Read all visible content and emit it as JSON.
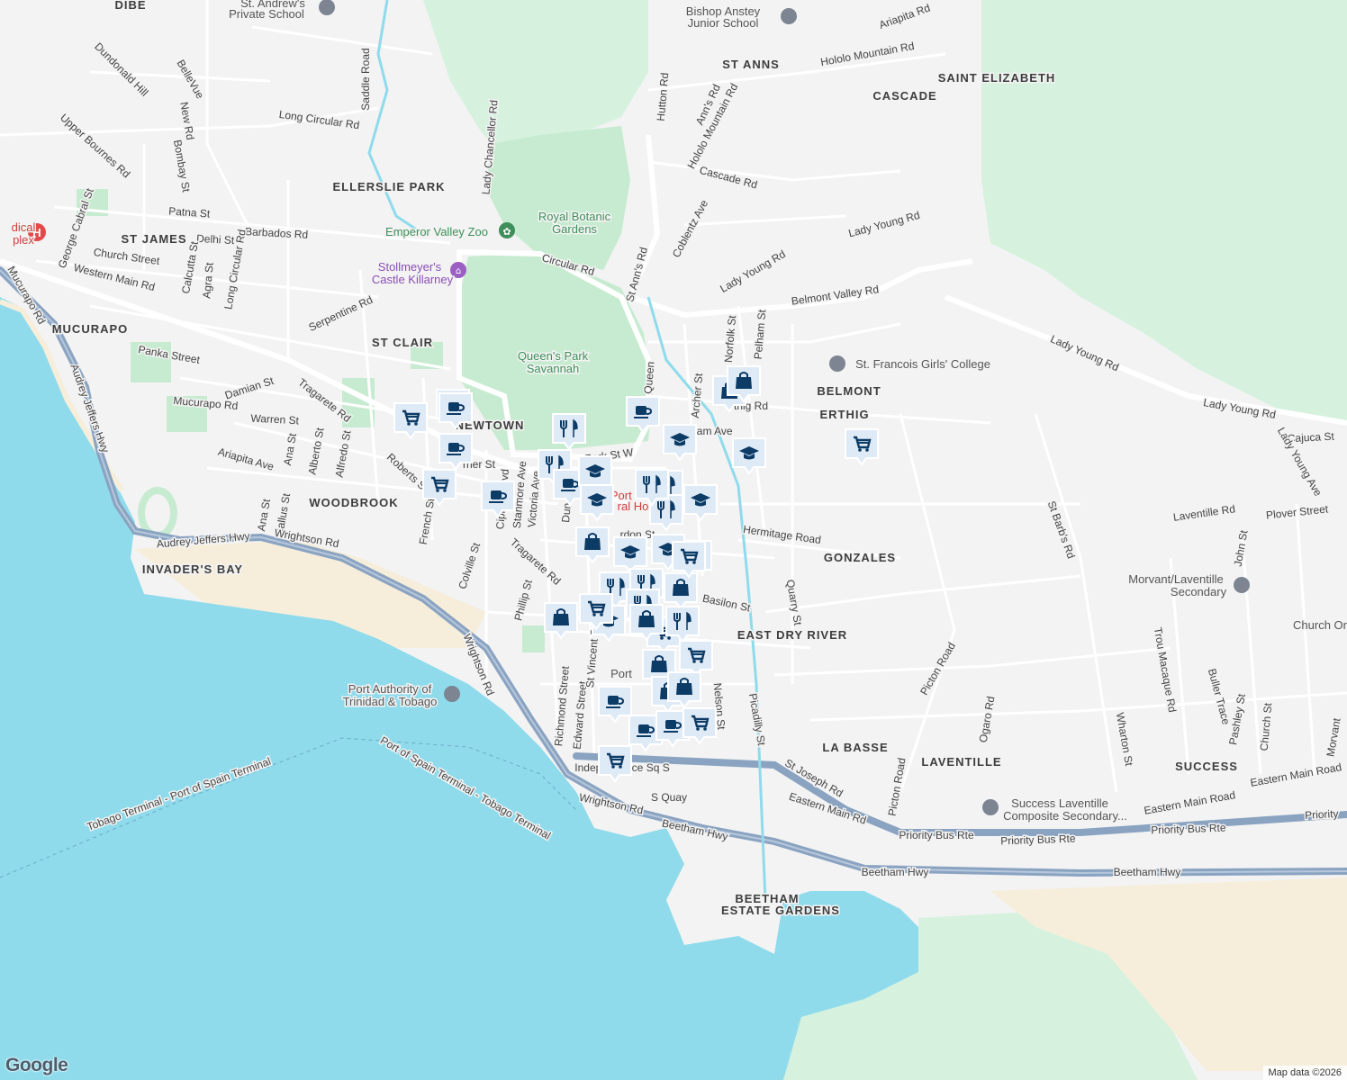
{
  "map": {
    "attribution": "Map data ©2026",
    "logo": "Google",
    "colors": {
      "water": "#8fdbec",
      "land": "#f3f3f3",
      "park": "#c7ebd0",
      "forest": "#d6f2df",
      "highway": "#8aa3c1",
      "road": "#ffffff",
      "marker": "#0c3b66",
      "marker_bg": "#dfeaf7",
      "sand": "#f6eedb"
    },
    "neighborhoods": [
      {
        "id": "dibe",
        "text": "DIBE"
      },
      {
        "id": "st-anns",
        "text": "ST ANNS"
      },
      {
        "id": "cascade",
        "text": "CASCADE"
      },
      {
        "id": "saint-elizabeth",
        "text": "SAINT ELIZABETH"
      },
      {
        "id": "ellerslie-park",
        "text": "ELLERSLIE PARK"
      },
      {
        "id": "st-james",
        "text": "ST JAMES"
      },
      {
        "id": "mucurapo",
        "text": "MUCURAPO"
      },
      {
        "id": "st-clair",
        "text": "ST CLAIR"
      },
      {
        "id": "newtown",
        "text": "NEWTOWN"
      },
      {
        "id": "belmont",
        "text": "BELMONT"
      },
      {
        "id": "erthig",
        "text": "ERTHIG"
      },
      {
        "id": "woodbrook",
        "text": "WOODBROOK"
      },
      {
        "id": "invaders-bay",
        "text": "INVADER'S BAY"
      },
      {
        "id": "gonzales",
        "text": "GONZALES"
      },
      {
        "id": "east-dry-river",
        "text": "EAST DRY RIVER"
      },
      {
        "id": "la-basse",
        "text": "LA BASSE"
      },
      {
        "id": "laventille",
        "text": "LAVENTILLE"
      },
      {
        "id": "success",
        "text": "SUCCESS"
      },
      {
        "id": "beetham",
        "text": "BEETHAM"
      },
      {
        "id": "estate-gardens",
        "text": "ESTATE GARDENS"
      }
    ],
    "pois": [
      {
        "id": "st-andrews",
        "text": "St. Andrew's",
        "style": "gray"
      },
      {
        "id": "st-andrews-2",
        "text": "Private School",
        "style": "gray"
      },
      {
        "id": "bishop-anstey",
        "text": "Bishop Anstey",
        "style": "gray"
      },
      {
        "id": "bishop-anstey-2",
        "text": "Junior School",
        "style": "gray"
      },
      {
        "id": "royal-botanic",
        "text": "Royal Botanic",
        "style": "green"
      },
      {
        "id": "royal-botanic-2",
        "text": "Gardens",
        "style": "green"
      },
      {
        "id": "emperor-zoo",
        "text": "Emperor Valley Zoo",
        "style": "green"
      },
      {
        "id": "stollmeyers",
        "text": "Stollmeyer's",
        "style": "purple"
      },
      {
        "id": "stollmeyers-2",
        "text": "Castle Killarney",
        "style": "purple"
      },
      {
        "id": "queens-park",
        "text": "Queen's Park",
        "style": "green"
      },
      {
        "id": "queens-park-2",
        "text": "Savannah",
        "style": "green"
      },
      {
        "id": "st-francois",
        "text": "St. Francois Girls' College",
        "style": "gray"
      },
      {
        "id": "medical",
        "text": "dical",
        "style": "red"
      },
      {
        "id": "medical-2",
        "text": "plex",
        "style": "red"
      },
      {
        "id": "port-of",
        "text": "Port of",
        "style": "red"
      },
      {
        "id": "ral-ho",
        "text": "ral Ho",
        "style": "red"
      },
      {
        "id": "morvant",
        "text": "Morvant/Laventille",
        "style": "gray"
      },
      {
        "id": "morvant-2",
        "text": "Secondary",
        "style": "gray"
      },
      {
        "id": "church-or",
        "text": "Church Or",
        "style": "gray"
      },
      {
        "id": "success-lav",
        "text": "Success Laventille",
        "style": "gray"
      },
      {
        "id": "success-lav-2",
        "text": "Composite Secondary...",
        "style": "gray"
      },
      {
        "id": "port-authority",
        "text": "Port Authority of",
        "style": "gray"
      },
      {
        "id": "port-authority-2",
        "text": "Trinidad & Tobago",
        "style": "gray"
      },
      {
        "id": "port-of-spain",
        "text": "Port",
        "style": "gray"
      }
    ],
    "roads": [
      {
        "id": "saddle-road",
        "text": "Saddle Road"
      },
      {
        "id": "long-circular-rd",
        "text": "Long Circular Rd"
      },
      {
        "id": "dundonald-hill",
        "text": "Dundonald Hill"
      },
      {
        "id": "belle-vue",
        "text": "BelleVue"
      },
      {
        "id": "new-rd",
        "text": "New Rd"
      },
      {
        "id": "upper-bournes-rd",
        "text": "Upper Bournes Rd"
      },
      {
        "id": "bombay-st",
        "text": "Bombay St"
      },
      {
        "id": "patna-st",
        "text": "Patna St"
      },
      {
        "id": "george-cabral-st",
        "text": "George Cabral St"
      },
      {
        "id": "delhi-st",
        "text": "Delhi St"
      },
      {
        "id": "barbados-rd",
        "text": "Barbados Rd"
      },
      {
        "id": "church-street",
        "text": "Church Street"
      },
      {
        "id": "western-main-rd",
        "text": "Western Main Rd"
      },
      {
        "id": "calcutta-st",
        "text": "Calcutta St"
      },
      {
        "id": "agra-st",
        "text": "Agra St"
      },
      {
        "id": "long-circular-rd-2",
        "text": "Long Circular Rd"
      },
      {
        "id": "mucurapo-rd",
        "text": "Mucurapo Rd"
      },
      {
        "id": "panka-street",
        "text": "Panka Street"
      },
      {
        "id": "serpentine-rd",
        "text": "Serpentine Rd"
      },
      {
        "id": "audrey-jeffers-hwy",
        "text": "Audrey Jeffers Hwy"
      },
      {
        "id": "damian-st",
        "text": "Damian St"
      },
      {
        "id": "tragarete-rd",
        "text": "Tragarete Rd"
      },
      {
        "id": "mucurapo-rd-2",
        "text": "Mucurapo Rd"
      },
      {
        "id": "warren-st",
        "text": "Warren St"
      },
      {
        "id": "ariapita-ave",
        "text": "Ariapita Ave"
      },
      {
        "id": "ana-st",
        "text": "Ana St"
      },
      {
        "id": "alberto-st",
        "text": "Alberto St"
      },
      {
        "id": "alfredo-st",
        "text": "Alfredo St"
      },
      {
        "id": "roberts-st",
        "text": "Roberts St"
      },
      {
        "id": "gallus-st",
        "text": "Gallus St"
      },
      {
        "id": "ana-st-2",
        "text": "Ana St"
      },
      {
        "id": "french-st",
        "text": "French St"
      },
      {
        "id": "audrey-jeffers-hwy-2",
        "text": "Audrey Jeffers Hwy"
      },
      {
        "id": "wrightson-rd",
        "text": "Wrightson Rd"
      },
      {
        "id": "colville-st",
        "text": "Colville St"
      },
      {
        "id": "tragarete-rd-2",
        "text": "Tragarete Rd"
      },
      {
        "id": "phillip-st",
        "text": "Phillip St"
      },
      {
        "id": "wrightson-rd-2",
        "text": "Wrightson Rd"
      },
      {
        "id": "lady-chancellor-rd",
        "text": "Lady Chancellor Rd"
      },
      {
        "id": "circular-rd",
        "text": "Circular Rd"
      },
      {
        "id": "st-anns-rd",
        "text": "St Ann's Rd"
      },
      {
        "id": "coblentz-ave",
        "text": "Coblentz Ave"
      },
      {
        "id": "lady-young-rd",
        "text": "Lady Young Rd"
      },
      {
        "id": "lady-young-rd-2",
        "text": "Lady Young Rd"
      },
      {
        "id": "belmont-valley-rd",
        "text": "Belmont Valley Rd"
      },
      {
        "id": "lady-young-rd-3",
        "text": "Lady Young Rd"
      },
      {
        "id": "lady-young-rd-4",
        "text": "Lady Young Rd"
      },
      {
        "id": "hutton-rd",
        "text": "Hutton Rd"
      },
      {
        "id": "st-anns-rd-2",
        "text": "Ann's Rd"
      },
      {
        "id": "hololo-mountain-rd",
        "text": "Hololo Mountain Rd"
      },
      {
        "id": "hololo-mountain-rd-2",
        "text": "Hololo Mountain Rd"
      },
      {
        "id": "cascade-rd",
        "text": "Cascade Rd"
      },
      {
        "id": "ariapita-rd",
        "text": "Ariapita Rd"
      },
      {
        "id": "norfolk-st",
        "text": "Norfolk St"
      },
      {
        "id": "pelham-st",
        "text": "Pelham St"
      },
      {
        "id": "archer-st",
        "text": "Archer St"
      },
      {
        "id": "erthig-rd",
        "text": "rthig Rd"
      },
      {
        "id": "queen-mary",
        "text": "Queen"
      },
      {
        "id": "hermitage-road",
        "text": "Hermitage Road"
      },
      {
        "id": "basilon-st",
        "text": "Basilon St"
      },
      {
        "id": "quarry-st",
        "text": "Quarry St"
      },
      {
        "id": "picton-road",
        "text": "Picton Road"
      },
      {
        "id": "picton-road-2",
        "text": "Picton Road"
      },
      {
        "id": "ogaro-rd",
        "text": "Ogaro Rd"
      },
      {
        "id": "st-barbs-rd",
        "text": "St Barb's Rd"
      },
      {
        "id": "wharton-st",
        "text": "Wharton St"
      },
      {
        "id": "trou-macaque-rd",
        "text": "Trou Macaque Rd"
      },
      {
        "id": "buller-trace",
        "text": "Buller Trace"
      },
      {
        "id": "pashley-st",
        "text": "Pashley St"
      },
      {
        "id": "church-st",
        "text": "Church St"
      },
      {
        "id": "morvant-st",
        "text": "Morvant"
      },
      {
        "id": "john-st",
        "text": "John St"
      },
      {
        "id": "laventille-rd",
        "text": "Laventille Rd"
      },
      {
        "id": "plover-street",
        "text": "Plover Street"
      },
      {
        "id": "cajuca-st",
        "text": "Cajuca St"
      },
      {
        "id": "lady-young-ave",
        "text": "Lady Young Ave"
      },
      {
        "id": "picadilly-st",
        "text": "Picadilly St"
      },
      {
        "id": "nelson-st",
        "text": "Nelson St"
      },
      {
        "id": "st-joseph-rd",
        "text": "St Joseph Rd"
      },
      {
        "id": "eastern-main-rd",
        "text": "Eastern Main Rd"
      },
      {
        "id": "eastern-main-road",
        "text": "Eastern Main Road"
      },
      {
        "id": "eastern-main-road-2",
        "text": "Eastern Main Road"
      },
      {
        "id": "priority-bus-rte",
        "text": "Priority Bus Rte"
      },
      {
        "id": "priority-bus-rte-2",
        "text": "Priority Bus Rte"
      },
      {
        "id": "priority-bus-rte-3",
        "text": "Priority Bus Rte"
      },
      {
        "id": "priority-4",
        "text": "Priority"
      },
      {
        "id": "beetham-hwy",
        "text": "Beetham Hwy"
      },
      {
        "id": "beetham-hwy-2",
        "text": "Beetham Hwy"
      },
      {
        "id": "beetham-hwy-3",
        "text": "Beetham Hwy"
      },
      {
        "id": "wrightson-rd-3",
        "text": "Wrightson Rd"
      },
      {
        "id": "s-quay",
        "text": "S Quay"
      },
      {
        "id": "independence-sq",
        "text": "Independence Sq S"
      },
      {
        "id": "richmond-street",
        "text": "Richmond Street"
      },
      {
        "id": "edward-street",
        "text": "Edward Street"
      },
      {
        "id": "st-vincent-st",
        "text": "St Vincent St"
      },
      {
        "id": "victoria-ave",
        "text": "Victoria Ave"
      },
      {
        "id": "stanmore-ave",
        "text": "Stanmore Ave"
      },
      {
        "id": "cipriani-blvd",
        "text": "Cipriani Blvd"
      },
      {
        "id": "dundonald-st",
        "text": "Dun"
      },
      {
        "id": "park-st",
        "text": "Park St W"
      },
      {
        "id": "gordon-st",
        "text": "rdon St"
      },
      {
        "id": "pembroke",
        "text": "rner St"
      },
      {
        "id": "belmont-ave",
        "text": "gham Ave"
      },
      {
        "id": "tobago-terminal",
        "text": "Tobago Terminal - Port of Spain Terminal"
      },
      {
        "id": "pos-terminal",
        "text": "Port of Spain Terminal - Tobago Terminal"
      }
    ],
    "markers": [
      {
        "icon": "shopping-cart-icon"
      },
      {
        "icon": "coffee-icon"
      },
      {
        "icon": "coffee-icon"
      },
      {
        "icon": "coffee-icon"
      },
      {
        "icon": "shopping-cart-icon"
      },
      {
        "icon": "coffee-icon"
      },
      {
        "icon": "restaurant-icon"
      },
      {
        "icon": "restaurant-icon"
      },
      {
        "icon": "coffee-icon"
      },
      {
        "icon": "school-icon"
      },
      {
        "icon": "school-icon"
      },
      {
        "icon": "coffee-icon"
      },
      {
        "icon": "shopping-bag-icon"
      },
      {
        "icon": "shopping-bag-icon"
      },
      {
        "icon": "school-icon"
      },
      {
        "icon": "school-icon"
      },
      {
        "icon": "shopping-cart-icon"
      },
      {
        "icon": "shopping-cart-icon"
      },
      {
        "icon": "restaurant-icon"
      },
      {
        "icon": "restaurant-icon"
      },
      {
        "icon": "school-icon"
      },
      {
        "icon": "shopping-bag-icon"
      },
      {
        "icon": "school-icon"
      },
      {
        "icon": "school-icon"
      },
      {
        "icon": "shopping-cart-icon"
      },
      {
        "icon": "restaurant-icon"
      },
      {
        "icon": "restaurant-icon"
      },
      {
        "icon": "shopping-bag-icon"
      },
      {
        "icon": "shopping-bag-icon"
      },
      {
        "icon": "school-icon"
      },
      {
        "icon": "restaurant-icon"
      },
      {
        "icon": "shopping-cart-icon"
      },
      {
        "icon": "restaurant-icon"
      },
      {
        "icon": "shopping-bag-icon"
      },
      {
        "icon": "shopping-bag-icon"
      },
      {
        "icon": "shopping-cart-icon"
      },
      {
        "icon": "shopping-bag-icon"
      },
      {
        "icon": "shopping-bag-icon"
      },
      {
        "icon": "coffee-icon"
      },
      {
        "icon": "coffee-icon"
      },
      {
        "icon": "coffee-icon"
      },
      {
        "icon": "shopping-cart-icon"
      },
      {
        "icon": "shopping-cart-icon"
      },
      {
        "icon": "shopping-cart-icon"
      },
      {
        "icon": "restaurant-icon"
      }
    ]
  }
}
